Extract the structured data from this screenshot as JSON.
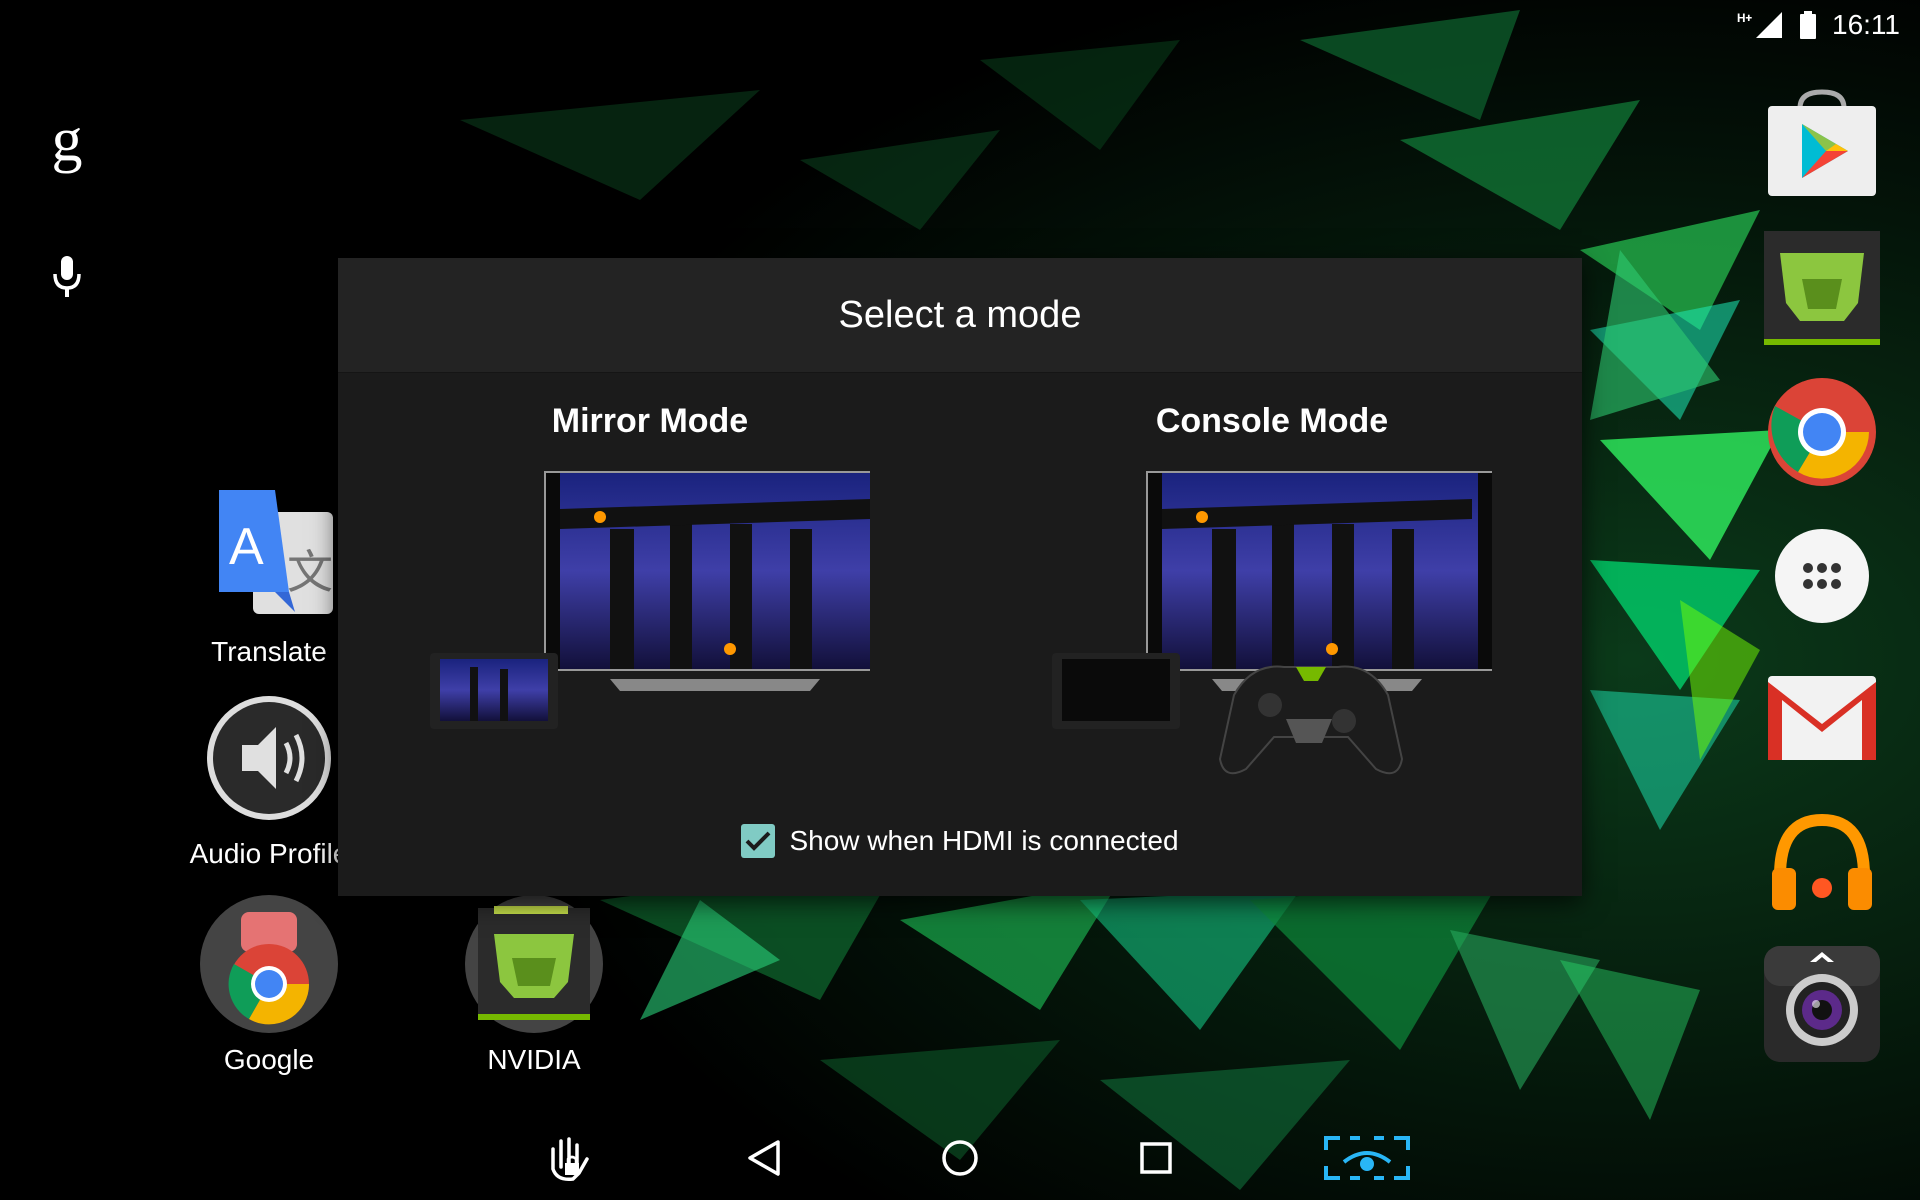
{
  "status_bar": {
    "network_type": "H+",
    "time": "16:11"
  },
  "left_rail": {
    "google_search_letter": "g",
    "icons": [
      "google-g-icon",
      "microphone-icon"
    ]
  },
  "desktop_apps": [
    {
      "label": "Translate",
      "icon": "translate-icon"
    },
    {
      "label": "Audio Profile",
      "icon": "speaker-icon"
    },
    {
      "label": "Google",
      "icon": "google-folder-icon"
    },
    {
      "label": "NVIDIA",
      "icon": "nvidia-shield-icon"
    }
  ],
  "dock_apps": [
    {
      "name": "Play Store",
      "icon": "play-store-icon"
    },
    {
      "name": "NVIDIA Hub",
      "icon": "nvidia-hub-icon"
    },
    {
      "name": "Chrome",
      "icon": "chrome-icon"
    },
    {
      "name": "Apps",
      "icon": "app-drawer-icon"
    },
    {
      "name": "Gmail",
      "icon": "gmail-icon"
    },
    {
      "name": "Play Music",
      "icon": "headphones-icon"
    },
    {
      "name": "Camera",
      "icon": "camera-icon"
    }
  ],
  "dialog": {
    "title": "Select a mode",
    "modes": [
      {
        "label": "Mirror Mode",
        "icon": "mirror-mode-illustration"
      },
      {
        "label": "Console Mode",
        "icon": "console-mode-illustration"
      }
    ],
    "checkbox": {
      "label": "Show when HDMI is connected",
      "checked": true,
      "color": "#80cbc4"
    }
  },
  "nav_bar": {
    "buttons": [
      "gesture-lock-icon",
      "back-icon",
      "home-icon",
      "recents-icon",
      "screenshot-icon"
    ],
    "accent_color": "#29b6f6"
  }
}
